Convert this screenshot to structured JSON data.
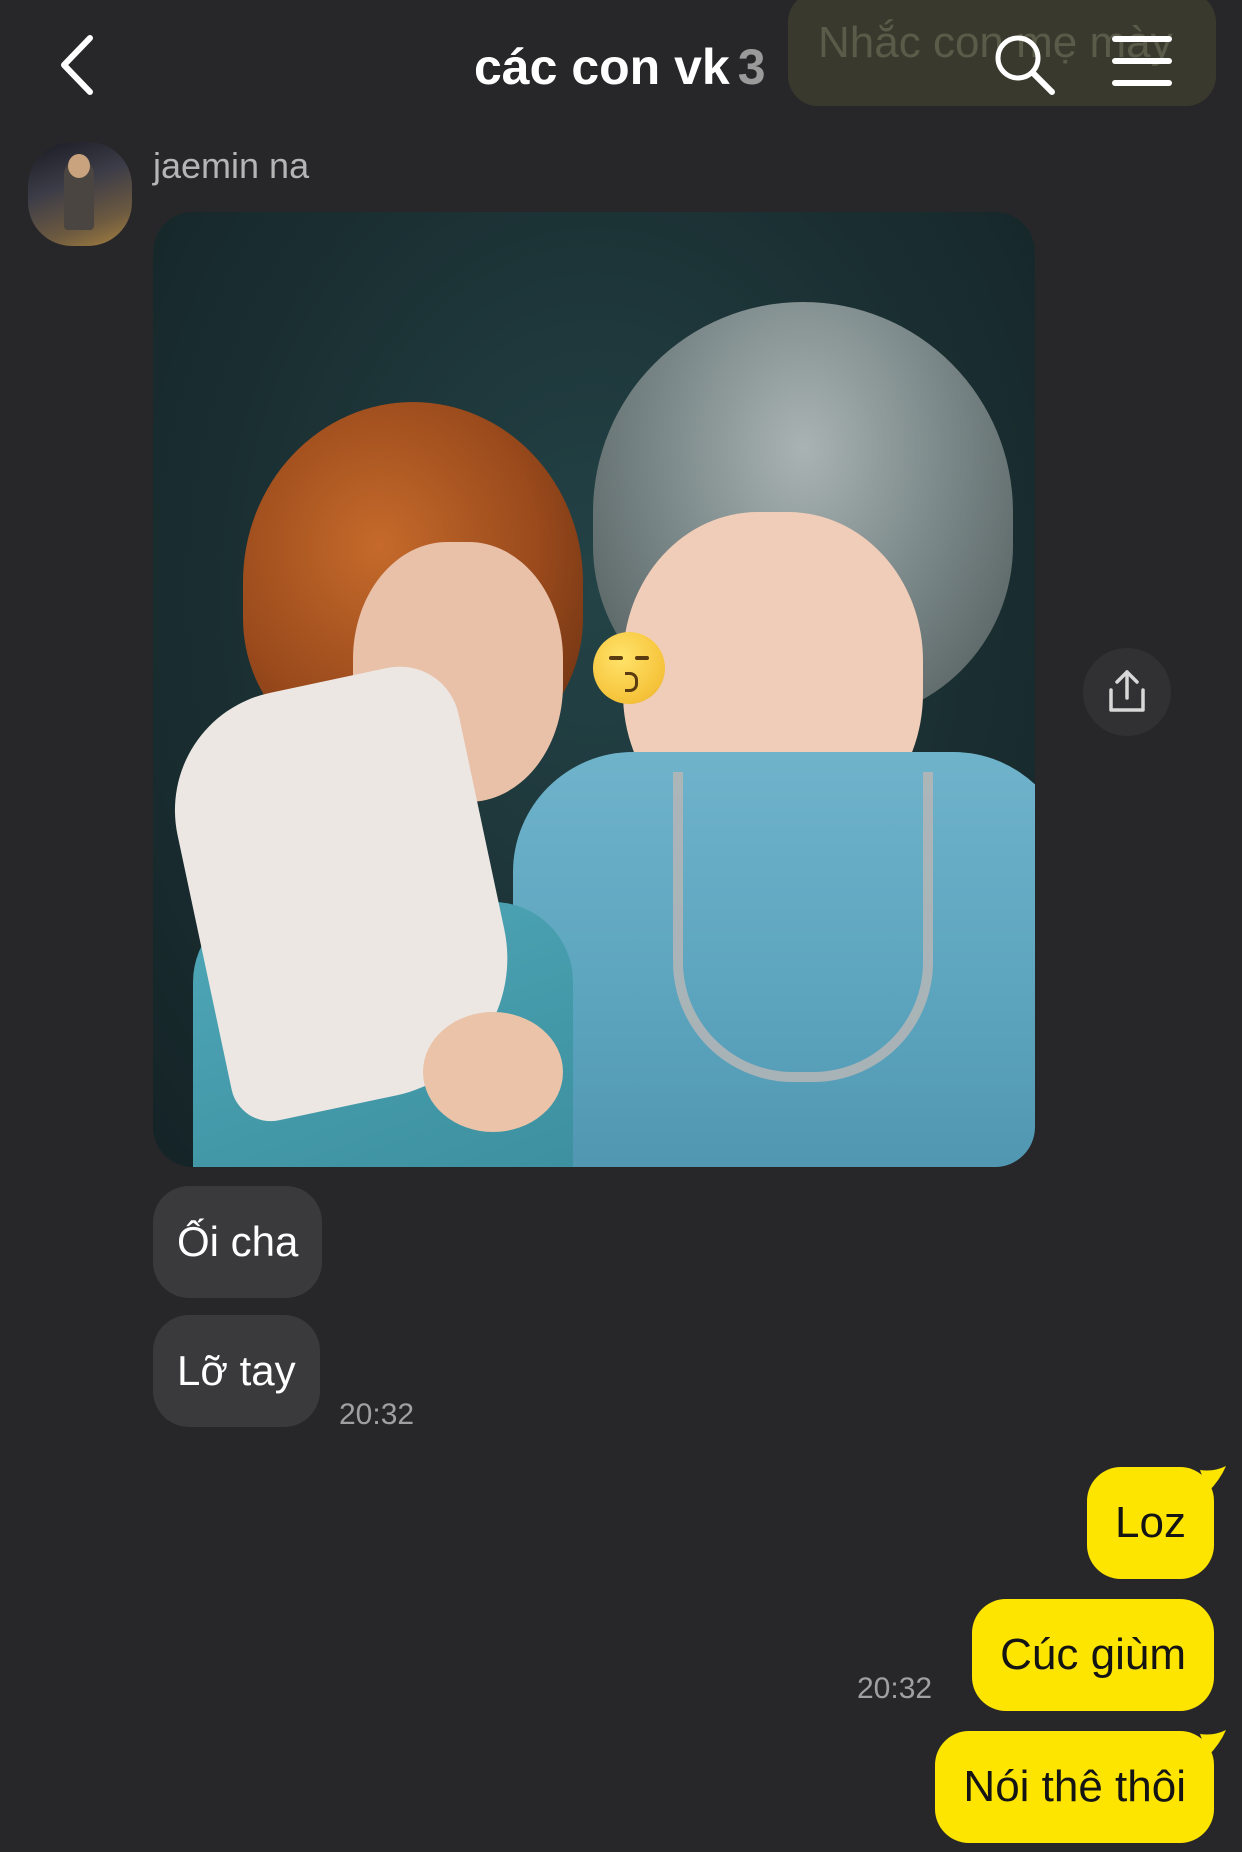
{
  "header": {
    "title": "các con vk",
    "member_count": "3",
    "notice": "Nhắc con mẹ mày",
    "back_icon": "chevron-left-icon",
    "search_icon": "search-icon",
    "menu_icon": "hamburger-menu-icon"
  },
  "incoming": {
    "sender_name": "jaemin na",
    "messages": [
      {
        "text": "Ối cha"
      },
      {
        "text": "Lỡ tay"
      }
    ],
    "time": "20:32"
  },
  "outgoing": {
    "messages": [
      {
        "text": "Loz"
      },
      {
        "text": "Cúc giùm"
      },
      {
        "text": "Nói thê thôi"
      }
    ],
    "time": "20:32"
  },
  "colors": {
    "background": "#27272a",
    "incoming_bubble": "#3a3a3c",
    "outgoing_bubble": "#fee500"
  }
}
